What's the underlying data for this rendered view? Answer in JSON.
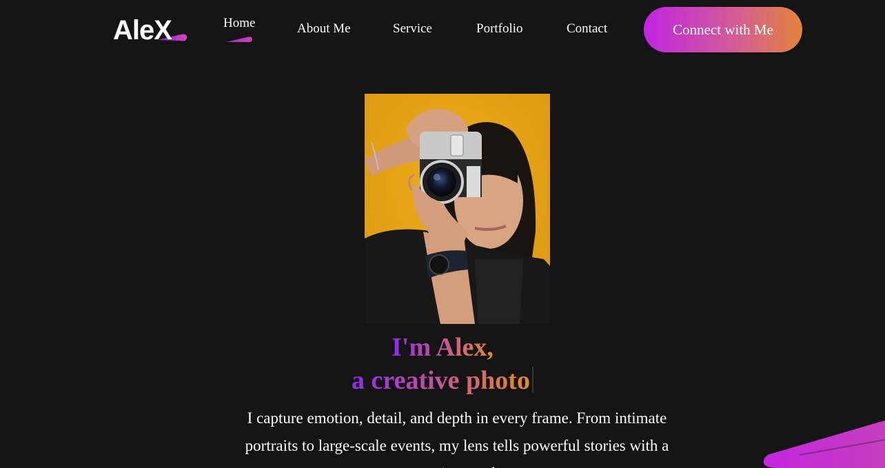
{
  "brand": {
    "logo_text": "AleX",
    "accent_colors": [
      "#c025e0",
      "#e4843a"
    ]
  },
  "nav": {
    "items": [
      {
        "label": "Home",
        "active": true
      },
      {
        "label": "About Me"
      },
      {
        "label": "Service"
      },
      {
        "label": "Portfolio"
      },
      {
        "label": "Contact"
      }
    ],
    "cta_label": "Connect with Me"
  },
  "hero": {
    "image_alt": "photographer-with-camera",
    "headline_line1": "I'm Alex,",
    "headline_line2": "a creative photo",
    "description": "I capture emotion, detail, and depth in every frame. From intimate portraits to large-scale events, my lens tells powerful stories with a creative touch."
  }
}
